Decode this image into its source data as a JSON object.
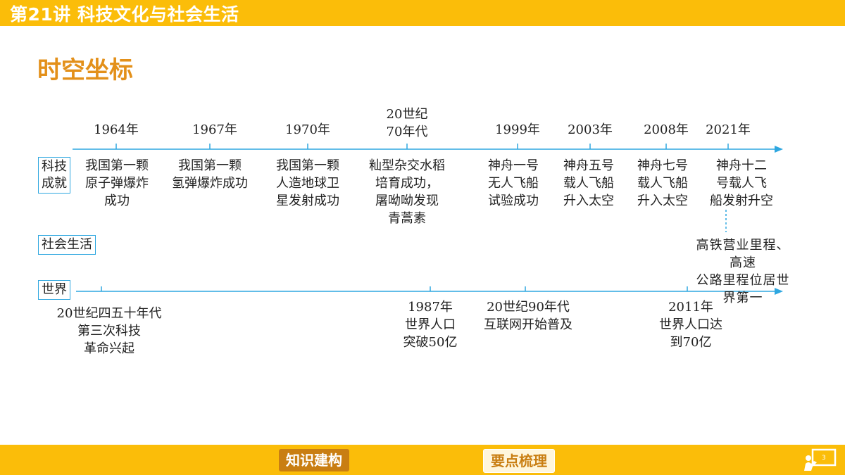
{
  "header": {
    "title": "第21讲 科技文化与社会生活"
  },
  "section": {
    "title": "时空坐标"
  },
  "labels": {
    "tech": "科技\n成就",
    "social": "社会生活",
    "world": "世界"
  },
  "tech_years": [
    "1964年",
    "1967年",
    "1970年",
    "20世纪\n70年代",
    "1999年",
    "2003年",
    "2008年",
    "2021年"
  ],
  "tech_events": [
    "我国第一颗\n原子弹爆炸\n成功",
    "我国第一颗\n氢弹爆炸成功",
    "我国第一颗\n人造地球卫\n星发射成功",
    "籼型杂交水稻\n培育成功，\n屠呦呦发现\n青蒿素",
    "神舟一号\n无人飞船\n试验成功",
    "神舟五号\n载人飞船\n升入太空",
    "神舟七号\n载人飞船\n升入太空",
    "神舟十二\n号载人飞\n船发射升空"
  ],
  "social_event": "高铁营业里程、高速\n公路里程位居世界第一",
  "world_events": [
    "20世纪四五十年代\n第三次科技\n革命兴起",
    "1987年\n世界人口\n突破50亿",
    "20世纪90年代\n互联网开始普及",
    "2011年\n世界人口达\n到70亿"
  ],
  "footer": {
    "nav_active": "知识建构",
    "nav_inactive": "要点梳理",
    "page": "3"
  },
  "colors": {
    "accent": "#fbbd09",
    "section_title": "#e3901a",
    "timeline": "#2ea7e0"
  },
  "icons": {
    "page_indicator": "presentation-board-icon"
  }
}
